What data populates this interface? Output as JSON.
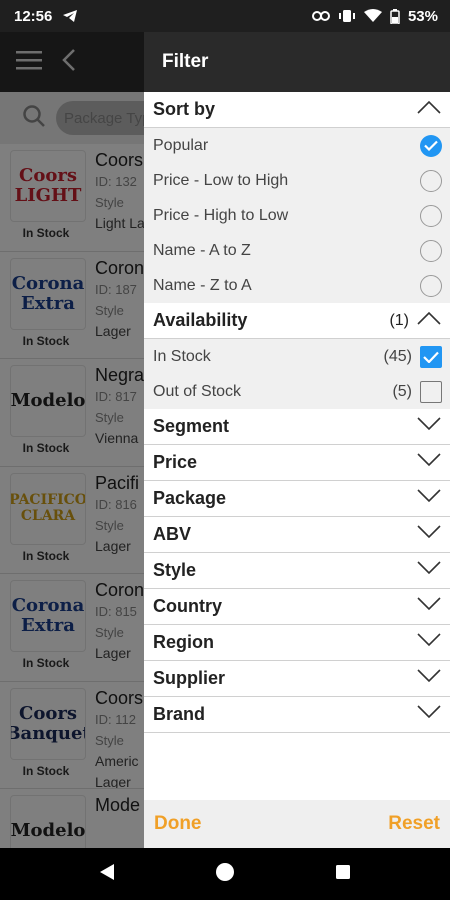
{
  "status_bar": {
    "time": "12:56",
    "battery": "53%",
    "icons": [
      "telegram-icon",
      "link-icon",
      "vibrate-icon",
      "wifi-icon",
      "battery-icon"
    ]
  },
  "app": {
    "search_placeholder": "Package Typ",
    "products": [
      {
        "logo": "Coors LIGHT",
        "stock": "In Stock",
        "name": "Coors",
        "id": "ID: 132",
        "style_label": "Style",
        "style": "Light La"
      },
      {
        "logo": "Corona Extra",
        "stock": "In Stock",
        "name": "Coron",
        "id": "ID: 187",
        "style_label": "Style",
        "style": "Lager"
      },
      {
        "logo": "Modelo",
        "stock": "In Stock",
        "name": "Negra",
        "id": "ID: 817",
        "style_label": "Style",
        "style": "Vienna"
      },
      {
        "logo": "PACIFICO CLARA",
        "stock": "In Stock",
        "name": "Pacifi",
        "id": "ID: 816",
        "style_label": "Style",
        "style": "Lager"
      },
      {
        "logo": "Corona Extra",
        "stock": "In Stock",
        "name": "Coron",
        "id": "ID: 815",
        "style_label": "Style",
        "style": "Lager"
      },
      {
        "logo": "Coors Banquet",
        "stock": "In Stock",
        "name": "Coors",
        "id": "ID: 112",
        "style_label": "Style",
        "style": "Americ",
        "style2": "Lager"
      },
      {
        "logo": "Modelo",
        "stock": "",
        "name": "Mode",
        "id": "",
        "style_label": "",
        "style": ""
      }
    ]
  },
  "filter": {
    "title": "Filter",
    "sort": {
      "title": "Sort by",
      "options": [
        {
          "label": "Popular",
          "selected": true
        },
        {
          "label": "Price - Low to High",
          "selected": false
        },
        {
          "label": "Price - High to Low",
          "selected": false
        },
        {
          "label": "Name - A to Z",
          "selected": false
        },
        {
          "label": "Name - Z to A",
          "selected": false
        }
      ]
    },
    "availability": {
      "title": "Availability",
      "count": "(1)",
      "options": [
        {
          "label": "In Stock",
          "count": "(45)",
          "checked": true
        },
        {
          "label": "Out of Stock",
          "count": "(5)",
          "checked": false
        }
      ]
    },
    "collapsed_sections": [
      "Segment",
      "Price",
      "Package",
      "ABV",
      "Style",
      "Country",
      "Region",
      "Supplier",
      "Brand"
    ],
    "done_label": "Done",
    "reset_label": "Reset"
  },
  "colors": {
    "accent": "#2196f3",
    "footer_action": "#f0a028",
    "header_bg": "#2a2a2a"
  }
}
